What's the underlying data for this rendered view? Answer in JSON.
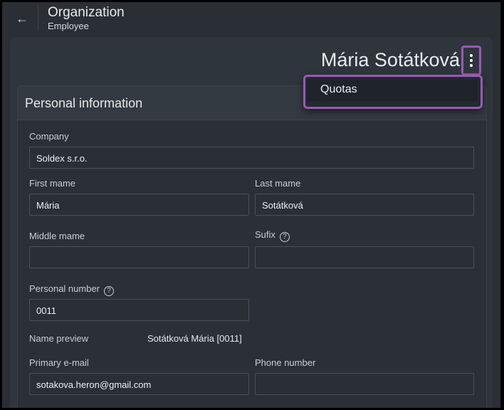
{
  "header": {
    "back_icon": "arrow-left-icon",
    "title": "Organization",
    "subtitle": "Employee"
  },
  "employee": {
    "name": "Mária Sotátková",
    "more_icon": "more-vertical-icon"
  },
  "menu": {
    "items": [
      {
        "label": "Quotas"
      }
    ]
  },
  "section": {
    "title": "Personal information",
    "fields": {
      "company": {
        "label": "Company",
        "value": "Soldex s.r.o."
      },
      "first_name": {
        "label": "First mame",
        "value": "Mária"
      },
      "last_name": {
        "label": "Last mame",
        "value": "Sotátková"
      },
      "middle_name": {
        "label": "Middle mame",
        "value": ""
      },
      "suffix": {
        "label": "Sufix",
        "value": "",
        "help_icon": "?"
      },
      "personal_number": {
        "label": "Personal number",
        "value": "0011",
        "help_icon": "?"
      },
      "name_preview": {
        "label": "Name preview",
        "value": "Sotátková Mária [0011]"
      },
      "email": {
        "label": "Primary e-mail",
        "value": "sotakova.heron@gmail.com"
      },
      "phone": {
        "label": "Phone number",
        "value": ""
      }
    }
  },
  "colors": {
    "background": "#2a2f36",
    "card": "#2f353d",
    "highlight": "#9b59b6"
  }
}
